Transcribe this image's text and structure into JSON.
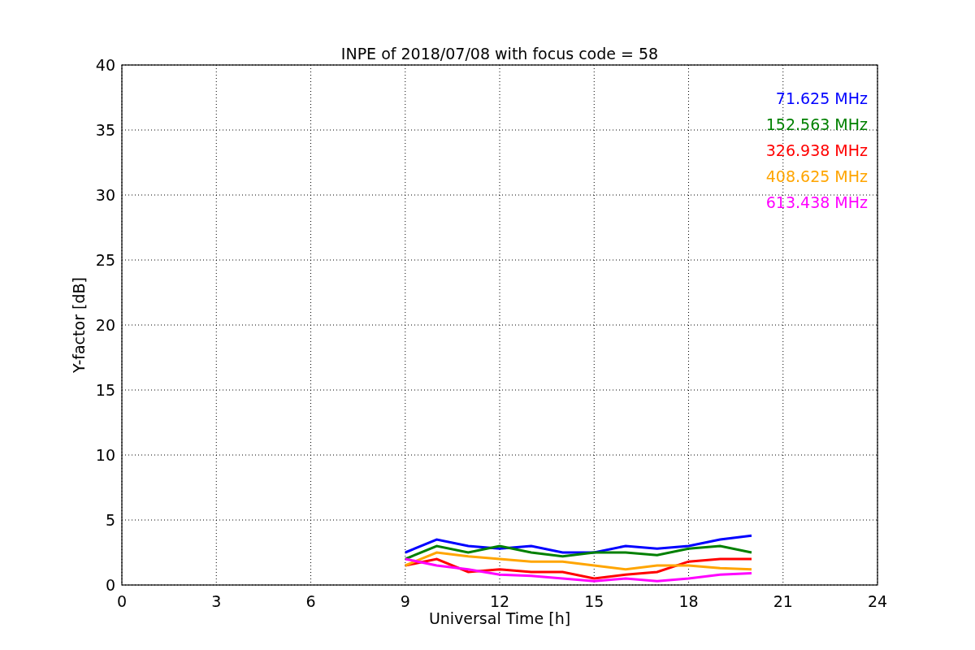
{
  "chart_data": {
    "type": "line",
    "title": "INPE of 2018/07/08 with focus code = 58",
    "xlabel": "Universal Time [h]",
    "ylabel": "Y-factor [dB]",
    "x": [
      9,
      10,
      11,
      12,
      13,
      14,
      15,
      16,
      17,
      18,
      19,
      20
    ],
    "series": [
      {
        "name": "71.625 MHz",
        "color": "#0000ff",
        "values": [
          2.5,
          3.5,
          3,
          2.8,
          3,
          2.5,
          2.5,
          3,
          2.8,
          3,
          3.5,
          3.8
        ]
      },
      {
        "name": "152.563 MHz",
        "color": "#008000",
        "values": [
          2,
          3,
          2.5,
          3,
          2.5,
          2.2,
          2.5,
          2.5,
          2.3,
          2.8,
          3,
          2.5
        ]
      },
      {
        "name": "326.938 MHz",
        "color": "#ff0000",
        "values": [
          1.5,
          2,
          1,
          1.2,
          1,
          1,
          0.5,
          0.8,
          1,
          1.8,
          2,
          2
        ]
      },
      {
        "name": "408.625 MHz",
        "color": "#ffa500",
        "values": [
          1.5,
          2.5,
          2.2,
          2,
          1.8,
          1.8,
          1.5,
          1.2,
          1.5,
          1.5,
          1.3,
          1.2
        ]
      },
      {
        "name": "613.438 MHz",
        "color": "#ff00ff",
        "values": [
          2,
          1.5,
          1.2,
          0.8,
          0.7,
          0.5,
          0.3,
          0.5,
          0.3,
          0.5,
          0.8,
          0.9
        ]
      }
    ],
    "grid": true,
    "xlim": [
      0,
      24
    ],
    "ylim": [
      0,
      40
    ],
    "xticks": [
      0,
      3,
      6,
      9,
      12,
      15,
      18,
      21,
      24
    ],
    "yticks": [
      0,
      5,
      10,
      15,
      20,
      25,
      30,
      35,
      40
    ]
  }
}
